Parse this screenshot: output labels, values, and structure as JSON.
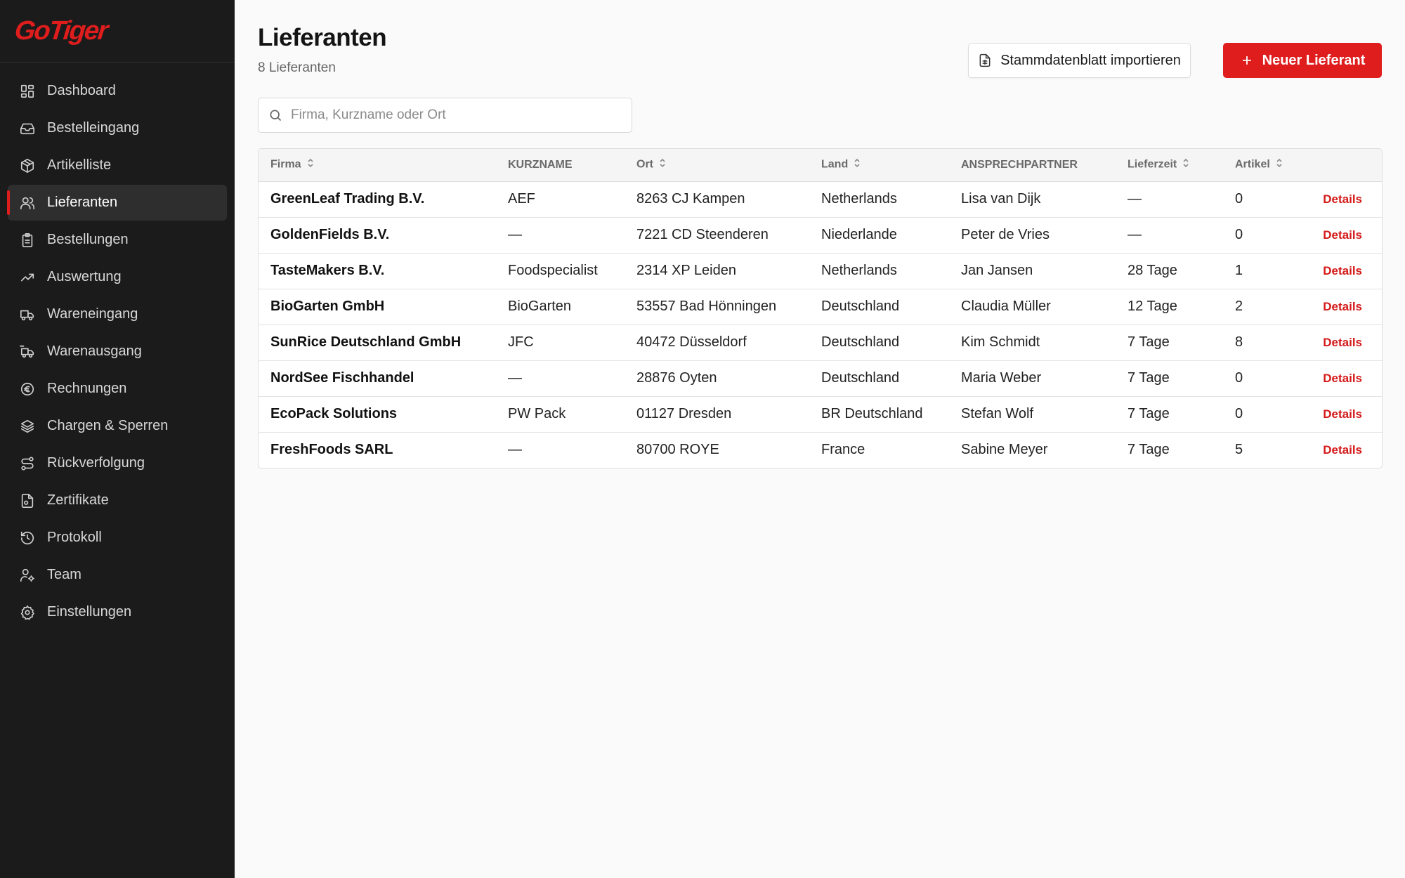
{
  "app": {
    "logo": "GoTiger",
    "brand_color": "#e01d1d"
  },
  "sidebar": {
    "items": [
      {
        "label": "Dashboard",
        "icon": "dashboard-icon",
        "active": false
      },
      {
        "label": "Bestelleingang",
        "icon": "inbox-icon",
        "active": false
      },
      {
        "label": "Artikelliste",
        "icon": "package-icon",
        "active": false
      },
      {
        "label": "Lieferanten",
        "icon": "users-icon",
        "active": true
      },
      {
        "label": "Bestellungen",
        "icon": "clipboard-icon",
        "active": false
      },
      {
        "label": "Auswertung",
        "icon": "trending-up-icon",
        "active": false
      },
      {
        "label": "Wareneingang",
        "icon": "truck-icon",
        "active": false
      },
      {
        "label": "Warenausgang",
        "icon": "truck-outgoing-icon",
        "active": false
      },
      {
        "label": "Rechnungen",
        "icon": "euro-icon",
        "active": false
      },
      {
        "label": "Chargen & Sperren",
        "icon": "layers-icon",
        "active": false
      },
      {
        "label": "Rückverfolgung",
        "icon": "route-icon",
        "active": false
      },
      {
        "label": "Zertifikate",
        "icon": "file-certificate-icon",
        "active": false
      },
      {
        "label": "Protokoll",
        "icon": "history-icon",
        "active": false
      },
      {
        "label": "Team",
        "icon": "user-cog-icon",
        "active": false
      },
      {
        "label": "Einstellungen",
        "icon": "gear-icon",
        "active": false
      }
    ]
  },
  "header": {
    "title": "Lieferanten",
    "subtitle": "8 Lieferanten",
    "import_label": "Stammdatenblatt importieren",
    "new_label": "Neuer Lieferant"
  },
  "search": {
    "placeholder": "Firma, Kurzname oder Ort",
    "value": ""
  },
  "table": {
    "columns": [
      "Firma",
      "KURZNAME",
      "Ort",
      "Land",
      "ANSPRECHPARTNER",
      "Lieferzeit",
      "Artikel"
    ],
    "details_label": "Details",
    "rows": [
      {
        "firma": "GreenLeaf Trading B.V.",
        "kurzname": "AEF",
        "ort": "8263 CJ Kampen",
        "land": "Netherlands",
        "ansprechpartner": "Lisa van Dijk",
        "lieferzeit": "—",
        "artikel": "0"
      },
      {
        "firma": "GoldenFields B.V.",
        "kurzname": "—",
        "ort": "7221 CD Steenderen",
        "land": "Niederlande",
        "ansprechpartner": "Peter de Vries",
        "lieferzeit": "—",
        "artikel": "0"
      },
      {
        "firma": "TasteMakers B.V.",
        "kurzname": "Foodspecialist",
        "ort": "2314 XP Leiden",
        "land": "Netherlands",
        "ansprechpartner": "Jan Jansen",
        "lieferzeit": "28 Tage",
        "artikel": "1"
      },
      {
        "firma": "BioGarten GmbH",
        "kurzname": "BioGarten",
        "ort": "53557 Bad Hönningen",
        "land": "Deutschland",
        "ansprechpartner": "Claudia Müller",
        "lieferzeit": "12 Tage",
        "artikel": "2"
      },
      {
        "firma": "SunRice Deutschland GmbH",
        "kurzname": "JFC",
        "ort": "40472 Düsseldorf",
        "land": "Deutschland",
        "ansprechpartner": "Kim Schmidt",
        "lieferzeit": "7 Tage",
        "artikel": "8"
      },
      {
        "firma": "NordSee Fischhandel",
        "kurzname": "—",
        "ort": "28876 Oyten",
        "land": "Deutschland",
        "ansprechpartner": "Maria Weber",
        "lieferzeit": "7 Tage",
        "artikel": "0"
      },
      {
        "firma": "EcoPack Solutions",
        "kurzname": "PW Pack",
        "ort": "01127 Dresden",
        "land": "BR Deutschland",
        "ansprechpartner": "Stefan Wolf",
        "lieferzeit": "7 Tage",
        "artikel": "0"
      },
      {
        "firma": "FreshFoods SARL",
        "kurzname": "—",
        "ort": "80700 ROYE",
        "land": "France",
        "ansprechpartner": "Sabine Meyer",
        "lieferzeit": "7 Tage",
        "artikel": "5"
      }
    ]
  }
}
